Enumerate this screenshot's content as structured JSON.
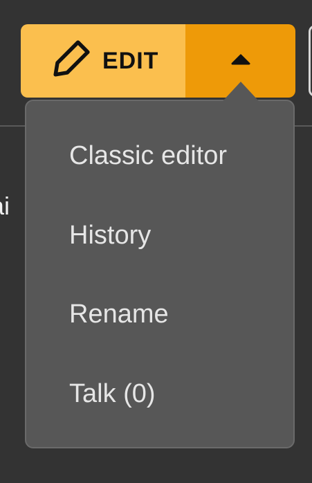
{
  "background": {
    "partial_text": "ai"
  },
  "edit_button": {
    "icon": "pencil-icon",
    "label": "EDIT",
    "toggle_icon": "caret-up-icon"
  },
  "menu": {
    "items": [
      {
        "label": "Classic editor"
      },
      {
        "label": "History"
      },
      {
        "label": "Rename"
      },
      {
        "label": "Talk (0)"
      }
    ]
  },
  "colors": {
    "background": "#333333",
    "edit_main": "#fbbf4e",
    "edit_toggle": "#ee9a08",
    "menu_bg": "#575757",
    "menu_text": "#e6e6e6"
  }
}
